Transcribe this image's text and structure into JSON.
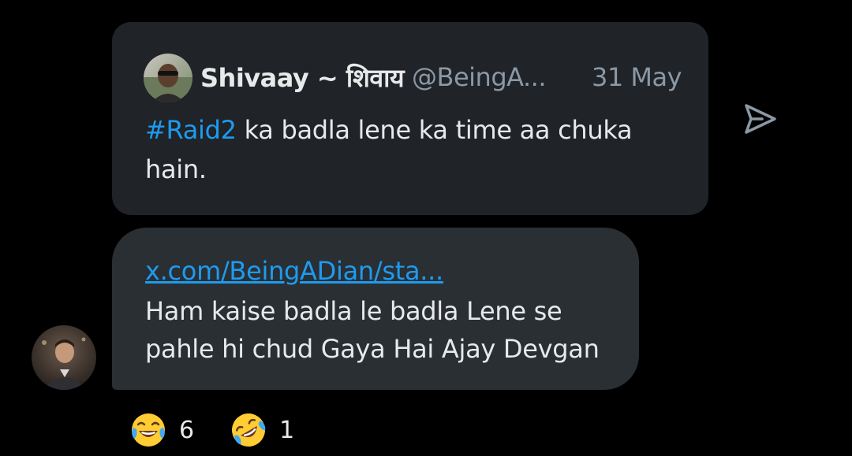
{
  "quote": {
    "name": "Shivaay ~ शिवाय",
    "handle": "@BeingA...",
    "date": "31 May",
    "hashtag": "#Raid2",
    "text": " ka badla lene ka time aa chuka hain."
  },
  "reply": {
    "link": "x.com/BeingADian/sta...",
    "text": "Ham kaise badla le badla Lene se pahle hi chud Gaya Hai Ajay Devgan"
  },
  "reactions": [
    {
      "icon": "face-with-tears-of-joy-icon",
      "count": "6"
    },
    {
      "icon": "rolling-on-floor-laughing-icon",
      "count": "1"
    }
  ],
  "colors": {
    "background": "#000000",
    "card": "#202327",
    "bubble": "#2a2f33",
    "link": "#1d9bf0",
    "text": "#e7e9ea",
    "muted": "#8b98a5"
  }
}
